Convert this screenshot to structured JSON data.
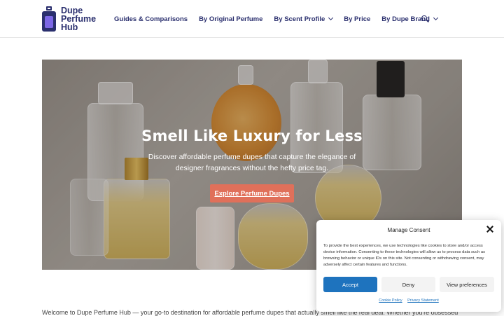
{
  "brand": {
    "line1": "Dupe",
    "line2": "Perfume",
    "line3": "Hub",
    "primary_color": "#2a2f6e",
    "accent_color": "#7c67e6"
  },
  "nav": {
    "items": [
      {
        "label": "Guides & Comparisons",
        "has_dropdown": false
      },
      {
        "label": "By Original Perfume",
        "has_dropdown": false
      },
      {
        "label": "By Scent Profile",
        "has_dropdown": true
      },
      {
        "label": "By Price",
        "has_dropdown": false
      },
      {
        "label": "By Dupe Brand",
        "has_dropdown": true
      }
    ],
    "search_icon": "search-icon"
  },
  "hero": {
    "title": "Smell Like Luxury for Less",
    "subtitle": "Discover affordable perfume dupes that capture the elegance of designer fragrances without the hefty price tag.",
    "cta_label": "Explore Perfume Dupes",
    "cta_color": "#e0705a"
  },
  "intro_text": "Welcome to Dupe Perfume Hub — your go-to destination for affordable perfume dupes that actually smell like the real deal. Whether you're obsessed",
  "consent": {
    "title": "Manage Consent",
    "body": "To provide the best experiences, we use technologies like cookies to store and/or access device information. Consenting to these technologies will allow us to process data such as browsing behavior or unique IDs on this site. Not consenting or withdrawing consent, may adversely affect certain features and functions.",
    "accept_label": "Accept",
    "deny_label": "Deny",
    "prefs_label": "View preferences",
    "cookie_policy_label": "Cookie Policy",
    "privacy_label": "Privacy Statement",
    "accept_color": "#1e73be"
  }
}
